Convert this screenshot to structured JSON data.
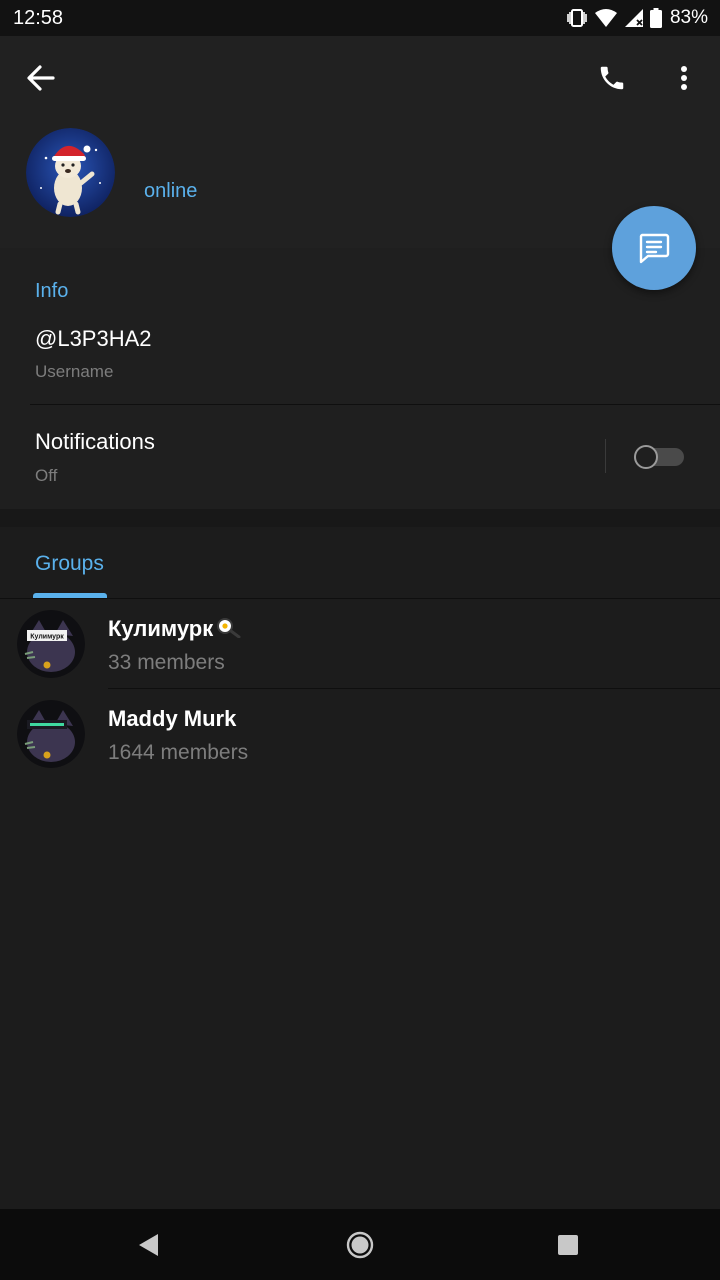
{
  "status_bar": {
    "time": "12:58",
    "battery": "83%"
  },
  "profile": {
    "status": "online"
  },
  "info": {
    "title": "Info",
    "username": "@L3P3HA2",
    "username_label": "Username",
    "notifications_label": "Notifications",
    "notifications_value": "Off",
    "notifications_enabled": false
  },
  "groups": {
    "tab_label": "Groups",
    "items": [
      {
        "name": "Кулимурк",
        "members": "33 members",
        "avatar_text": "Кулимурк"
      },
      {
        "name": "Maddy Murk",
        "members": "1644 members",
        "avatar_text": ""
      }
    ]
  },
  "colors": {
    "accent": "#5ab1ec",
    "fab": "#5ea1dc",
    "background": "#181818",
    "header": "#212121"
  }
}
